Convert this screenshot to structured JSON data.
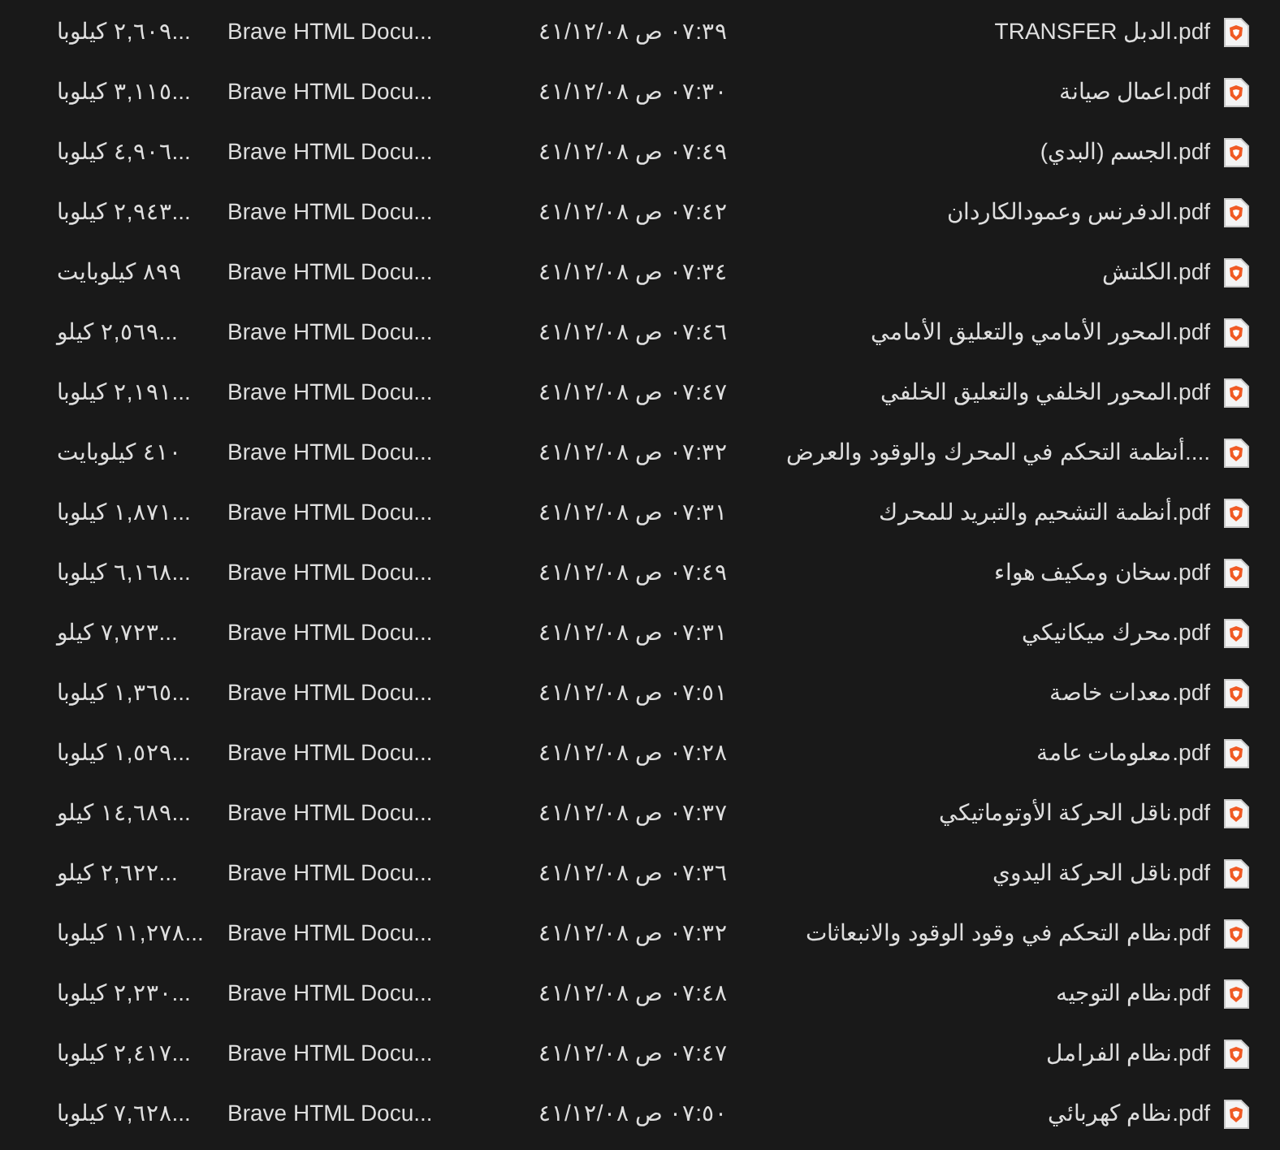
{
  "files": [
    {
      "name": "TRANSFER الدبل.pdf",
      "date": "٤١/١٢/٠٨ ص ٠٧:٣٩",
      "type": "Brave HTML Docu...",
      "size": "...٢,٦٠٩ كيلوبا"
    },
    {
      "name": "اعمال صيانة.pdf",
      "date": "٤١/١٢/٠٨ ص ٠٧:٣٠",
      "type": "Brave HTML Docu...",
      "size": "...٣,١١٥ كيلوبا"
    },
    {
      "name": "الجسم (البدي).pdf",
      "date": "٤١/١٢/٠٨ ص ٠٧:٤٩",
      "type": "Brave HTML Docu...",
      "size": "...٤,٩٠٦ كيلوبا"
    },
    {
      "name": "الدفرنس وعمودالكاردان.pdf",
      "date": "٤١/١٢/٠٨ ص ٠٧:٤٢",
      "type": "Brave HTML Docu...",
      "size": "...٢,٩٤٣ كيلوبا"
    },
    {
      "name": "الكلتش.pdf",
      "date": "٤١/١٢/٠٨ ص ٠٧:٣٤",
      "type": "Brave HTML Docu...",
      "size": "٨٩٩ كيلوبايت"
    },
    {
      "name": "المحور الأمامي والتعليق الأمامي.pdf",
      "date": "٤١/١٢/٠٨ ص ٠٧:٤٦",
      "type": "Brave HTML Docu...",
      "size": "...٢,٥٦٩ كيلو"
    },
    {
      "name": "المحور الخلفي والتعليق الخلفي.pdf",
      "date": "٤١/١٢/٠٨ ص ٠٧:٤٧",
      "type": "Brave HTML Docu...",
      "size": "...٢,١٩١ كيلوبا"
    },
    {
      "name": "أنظمة التحكم في المحرك والوقود والعرض....",
      "date": "٤١/١٢/٠٨ ص ٠٧:٣٢",
      "type": "Brave HTML Docu...",
      "size": "٤١٠ كيلوبايت"
    },
    {
      "name": "أنظمة التشحيم والتبريد للمحرك.pdf",
      "date": "٤١/١٢/٠٨ ص ٠٧:٣١",
      "type": "Brave HTML Docu...",
      "size": "...١,٨٧١ كيلوبا"
    },
    {
      "name": "سخان ومكيف هواء.pdf",
      "date": "٤١/١٢/٠٨ ص ٠٧:٤٩",
      "type": "Brave HTML Docu...",
      "size": "...٦,١٦٨ كيلوبا"
    },
    {
      "name": "محرك ميكانيكي.pdf",
      "date": "٤١/١٢/٠٨ ص ٠٧:٣١",
      "type": "Brave HTML Docu...",
      "size": "...٧,٧٢٣ كيلو"
    },
    {
      "name": "معدات خاصة.pdf",
      "date": "٤١/١٢/٠٨ ص ٠٧:٥١",
      "type": "Brave HTML Docu...",
      "size": "...١,٣٦٥ كيلوبا"
    },
    {
      "name": "معلومات عامة.pdf",
      "date": "٤١/١٢/٠٨ ص ٠٧:٢٨",
      "type": "Brave HTML Docu...",
      "size": "...١,٥٢٩ كيلوبا"
    },
    {
      "name": "ناقل الحركة الأوتوماتيكي.pdf",
      "date": "٤١/١٢/٠٨ ص ٠٧:٣٧",
      "type": "Brave HTML Docu...",
      "size": "...١٤,٦٨٩ كيلو"
    },
    {
      "name": "ناقل الحركة اليدوي.pdf",
      "date": "٤١/١٢/٠٨ ص ٠٧:٣٦",
      "type": "Brave HTML Docu...",
      "size": "...٢,٦٢٢ كيلو"
    },
    {
      "name": "نظام التحكم في وقود الوقود والانبعاثات.pdf",
      "date": "٤١/١٢/٠٨ ص ٠٧:٣٢",
      "type": "Brave HTML Docu...",
      "size": "...١١,٢٧٨ كيلوبا"
    },
    {
      "name": "نظام التوجيه.pdf",
      "date": "٤١/١٢/٠٨ ص ٠٧:٤٨",
      "type": "Brave HTML Docu...",
      "size": "...٢,٢٣٠ كيلوبا"
    },
    {
      "name": "نظام الفرامل.pdf",
      "date": "٤١/١٢/٠٨ ص ٠٧:٤٧",
      "type": "Brave HTML Docu...",
      "size": "...٢,٤١٧ كيلوبا"
    },
    {
      "name": "نظام كهربائي.pdf",
      "date": "٤١/١٢/٠٨ ص ٠٧:٥٠",
      "type": "Brave HTML Docu...",
      "size": "...٧,٦٢٨ كيلوبا"
    }
  ]
}
